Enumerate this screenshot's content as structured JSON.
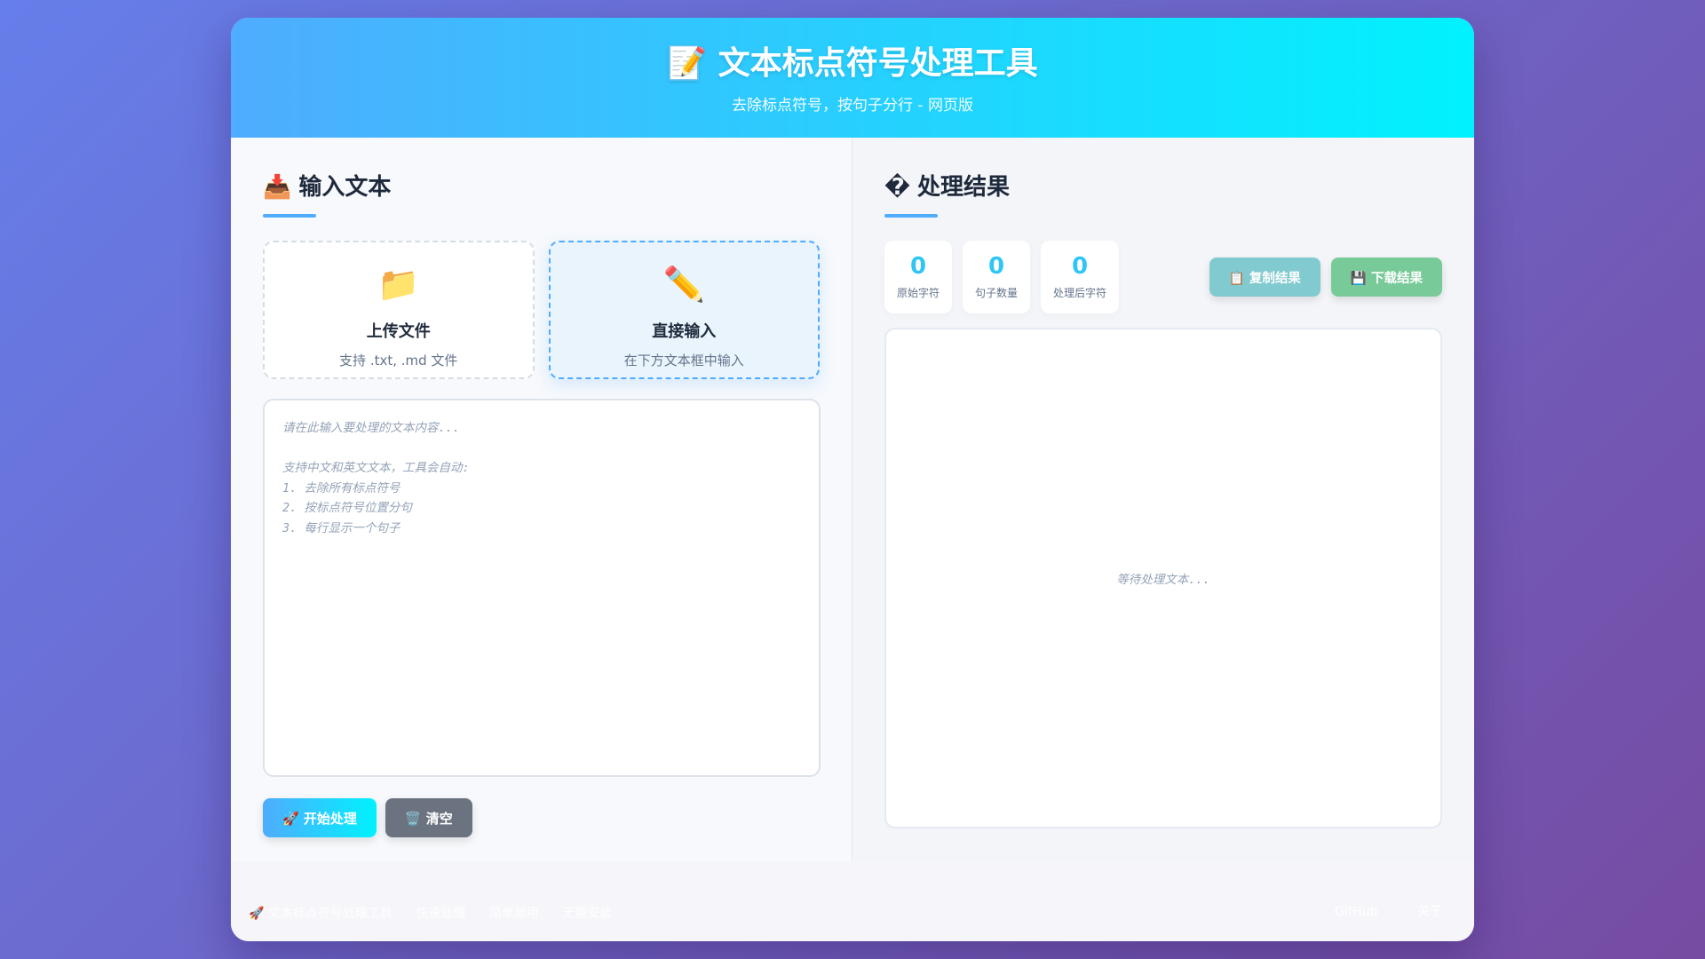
{
  "header": {
    "icon": "📝",
    "title": "文本标点符号处理工具",
    "subtitle": "去除标点符号，按句子分行 - 网页版"
  },
  "input_panel": {
    "icon": "📥",
    "title": "输入文本",
    "upload_card": {
      "icon": "📁",
      "title": "上传文件",
      "desc": "支持 .txt, .md 文件"
    },
    "direct_card": {
      "icon": "✏️",
      "title": "直接输入",
      "desc": "在下方文本框中输入"
    },
    "textarea_placeholder": "请在此输入要处理的文本内容...\n\n支持中文和英文文本，工具会自动:\n1. 去除所有标点符号\n2. 按标点符号位置分句\n3. 每行显示一个句子",
    "start_button": "🚀 开始处理",
    "clear_button": "🗑️ 清空"
  },
  "result_panel": {
    "icon": "�",
    "title": "处理结果",
    "stats": [
      {
        "value": "0",
        "label": "原始字符"
      },
      {
        "value": "0",
        "label": "句子数量"
      },
      {
        "value": "0",
        "label": "处理后字符"
      }
    ],
    "copy_button": "📋 复制结果",
    "download_button": "💾 下载结果",
    "placeholder": "等待处理文本..."
  },
  "footer": {
    "left_items": [
      "🚀 文本标点符号处理工具",
      "快速处理",
      "简单易用",
      "无需安装"
    ],
    "right_items": [
      "GitHub",
      "关于"
    ]
  },
  "colors": {
    "accent_start": "#4facfe",
    "accent_end": "#00f2fe",
    "bg_start": "#667eea",
    "bg_end": "#764ba2"
  }
}
